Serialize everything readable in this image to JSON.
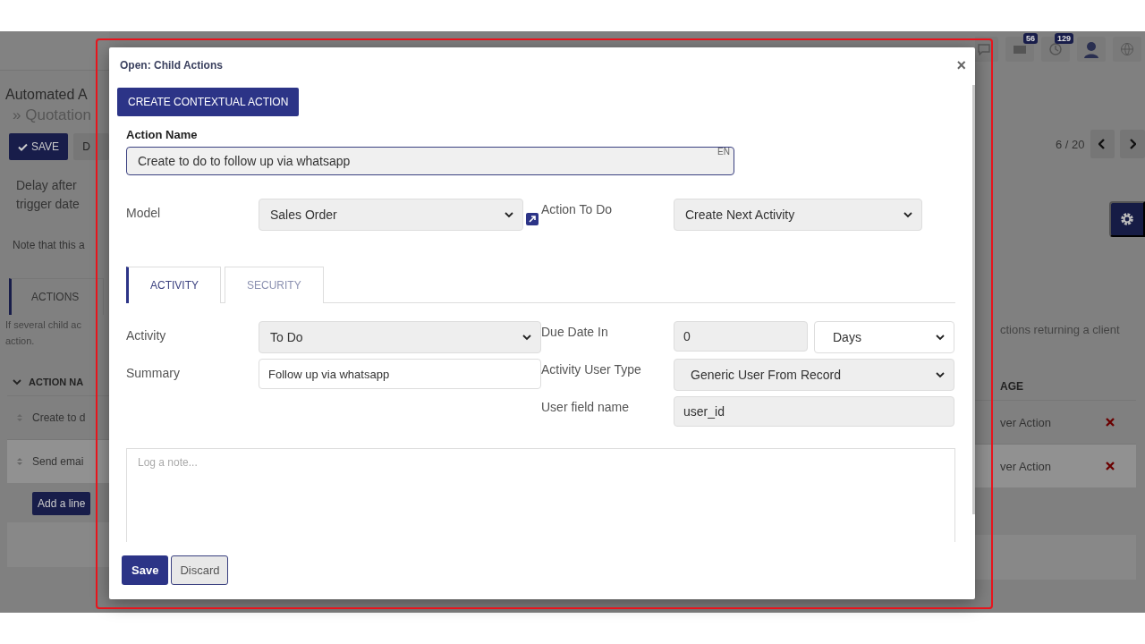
{
  "background": {
    "title": "Automated A",
    "breadcrumb_mark": "»",
    "breadcrumb": "Quotation",
    "save_button": "SAVE",
    "discard_button": "D",
    "pager": "6 / 20",
    "topbar_icons": [
      {
        "kind": "chat"
      },
      {
        "kind": "message",
        "badge": "56"
      },
      {
        "kind": "clock",
        "badge": "129"
      },
      {
        "kind": "avatar"
      },
      {
        "kind": "globe"
      }
    ],
    "delay_label": "Delay after trigger date",
    "note": "Note that this a",
    "tabs": [
      {
        "label": "ACTIONS",
        "selected": true
      }
    ],
    "help_left": [
      "If several child ac",
      "action."
    ],
    "help_right": "ctions returning a client",
    "table": {
      "column_1": "ACTION NA",
      "column_2": "AGE",
      "rows": [
        {
          "column_1": "Create to d",
          "column_2": "ver Action",
          "highlighted": false
        },
        {
          "column_1": "Send emai",
          "column_2": "ver Action",
          "highlighted": true
        }
      ]
    },
    "add_line": "Add a line"
  },
  "modal": {
    "title": "Open: Child Actions",
    "close": "×",
    "create_button": "CREATE CONTEXTUAL ACTION",
    "action_name": {
      "label": "Action Name",
      "value": "Create to do to follow up via whatsapp",
      "lang": "EN"
    },
    "model": {
      "label": "Model",
      "value": "Sales Order"
    },
    "action_to_do": {
      "label": "Action To Do",
      "value": "Create Next Activity"
    },
    "tabs": [
      {
        "label": "ACTIVITY",
        "selected": true
      },
      {
        "label": "SECURITY",
        "selected": false
      }
    ],
    "activity": {
      "label": "Activity",
      "value": "To Do"
    },
    "summary": {
      "label": "Summary",
      "value": "Follow up via whatsapp"
    },
    "due_date": {
      "label": "Due Date In",
      "value": "0",
      "unit": "Days"
    },
    "user_type": {
      "label": "Activity User Type",
      "value": "Generic User From Record"
    },
    "user_field": {
      "label": "User field name",
      "value": "user_id"
    },
    "note": {
      "placeholder": "Log a note..."
    },
    "buttons": {
      "save": "Save",
      "discard": "Discard"
    }
  }
}
